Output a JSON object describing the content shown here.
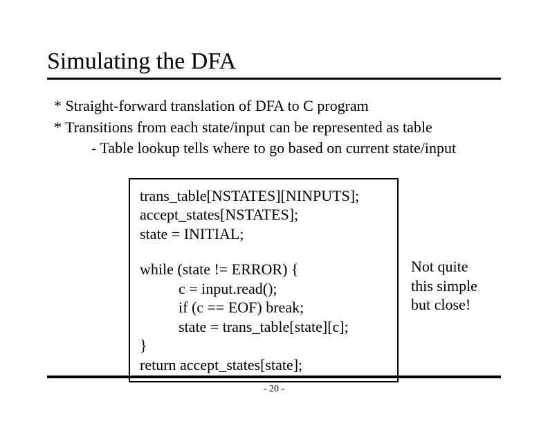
{
  "title": "Simulating the DFA",
  "bullets": {
    "b1": "* Straight-forward translation of DFA to C program",
    "b2": "* Transitions from each state/input can be represented as table",
    "b2a": "- Table lookup tells where to go based on current state/input"
  },
  "code": {
    "l1": "trans_table[NSTATES][NINPUTS];",
    "l2": "accept_states[NSTATES];",
    "l3": "state = INITIAL;",
    "l4": "while (state != ERROR) {",
    "l5": "c = input.read();",
    "l6": "if (c == EOF) break;",
    "l7": "state = trans_table[state][c];",
    "l8": "}",
    "l9": "return accept_states[state];"
  },
  "note": {
    "n1": "Not quite",
    "n2": "this simple",
    "n3": "but close!"
  },
  "page": "- 20 -"
}
